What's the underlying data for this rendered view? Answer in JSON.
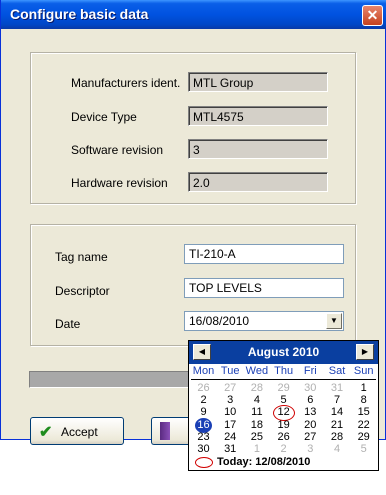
{
  "window": {
    "title": "Configure basic data",
    "close_icon": "close-icon"
  },
  "basic": {
    "manufacturer_label": "Manufacturers ident.",
    "manufacturer_value": "MTL Group",
    "device_type_label": "Device Type",
    "device_type_value": "MTL4575",
    "software_label": "Software revision",
    "software_value": "3",
    "hardware_label": "Hardware revision",
    "hardware_value": "2.0"
  },
  "editable": {
    "tag_label": "Tag name",
    "tag_value": "TI-210-A",
    "descriptor_label": "Descriptor",
    "descriptor_value": "TOP LEVELS",
    "date_label": "Date",
    "date_value": "16/08/2010"
  },
  "buttons": {
    "accept_label": "Accept",
    "accept_icon": "checkmark-icon",
    "partial_icon": "device-icon"
  },
  "calendar": {
    "month_label": "August 2010",
    "prev_icon": "arrow-left-icon",
    "next_icon": "arrow-right-icon",
    "weekdays": [
      "Mon",
      "Tue",
      "Wed",
      "Thu",
      "Fri",
      "Sat",
      "Sun"
    ],
    "weeks": [
      [
        "26",
        "27",
        "28",
        "29",
        "30",
        "31",
        "1"
      ],
      [
        "2",
        "3",
        "4",
        "5",
        "6",
        "7",
        "8"
      ],
      [
        "9",
        "10",
        "11",
        "12",
        "13",
        "14",
        "15"
      ],
      [
        "16",
        "17",
        "18",
        "19",
        "20",
        "21",
        "22"
      ],
      [
        "23",
        "24",
        "25",
        "26",
        "27",
        "28",
        "29"
      ],
      [
        "30",
        "31",
        "1",
        "2",
        "3",
        "4",
        "5"
      ]
    ],
    "today_day": "12",
    "selected_day": "16",
    "today_label": "Today: 12/08/2010"
  },
  "colors": {
    "titlebar": "#0052e0",
    "dialog_bg": "#ece9d8",
    "calendar_header": "#0a3fa0",
    "today_marker": "#d00000",
    "selected_marker": "#1a3fb5"
  }
}
